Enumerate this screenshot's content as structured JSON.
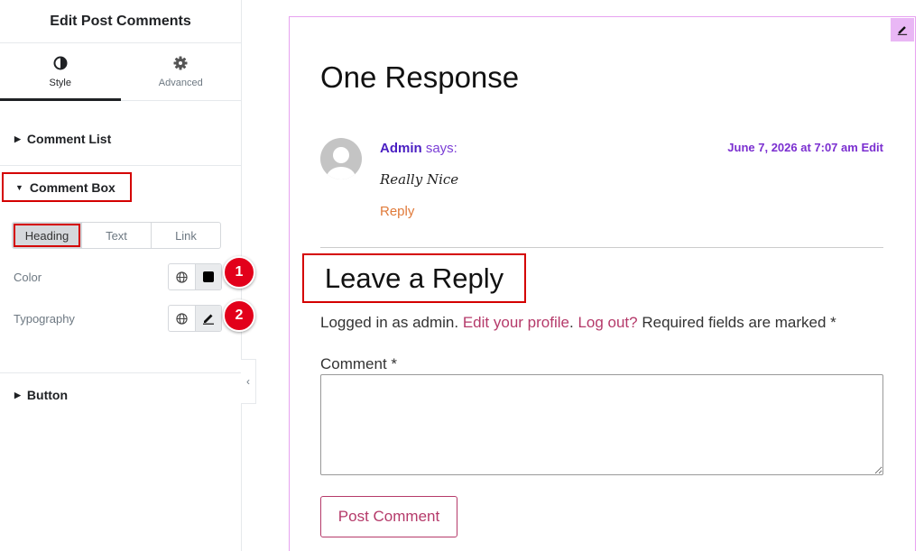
{
  "panel": {
    "title": "Edit Post Comments",
    "tabs": [
      {
        "label": "Style",
        "icon": "contrast-icon",
        "active": true
      },
      {
        "label": "Advanced",
        "icon": "gear-icon",
        "active": false
      }
    ],
    "sections": {
      "comment_list": "Comment List",
      "comment_box": "Comment Box",
      "button": "Button"
    },
    "segment": [
      "Heading",
      "Text",
      "Link"
    ],
    "controls": {
      "color_label": "Color",
      "typography_label": "Typography"
    },
    "badges": [
      "1",
      "2"
    ],
    "swatch_color": "#000000",
    "highlight_color": "#d40000"
  },
  "preview": {
    "comments_title": "One Response",
    "comment": {
      "author": "Admin",
      "says": "says:",
      "date": "June 7, 2026 at 7:07 am",
      "edit": "Edit",
      "text": "Really Nice",
      "reply": "Reply"
    },
    "reply_title": "Leave a Reply",
    "logged_in": {
      "prefix": "Logged in as admin.",
      "edit_profile": "Edit your profile",
      "separator": ".",
      "logout": "Log out?",
      "required": "Required fields are marked *"
    },
    "comment_label": "Comment *",
    "comment_value": "",
    "submit_label": "Post Comment"
  }
}
